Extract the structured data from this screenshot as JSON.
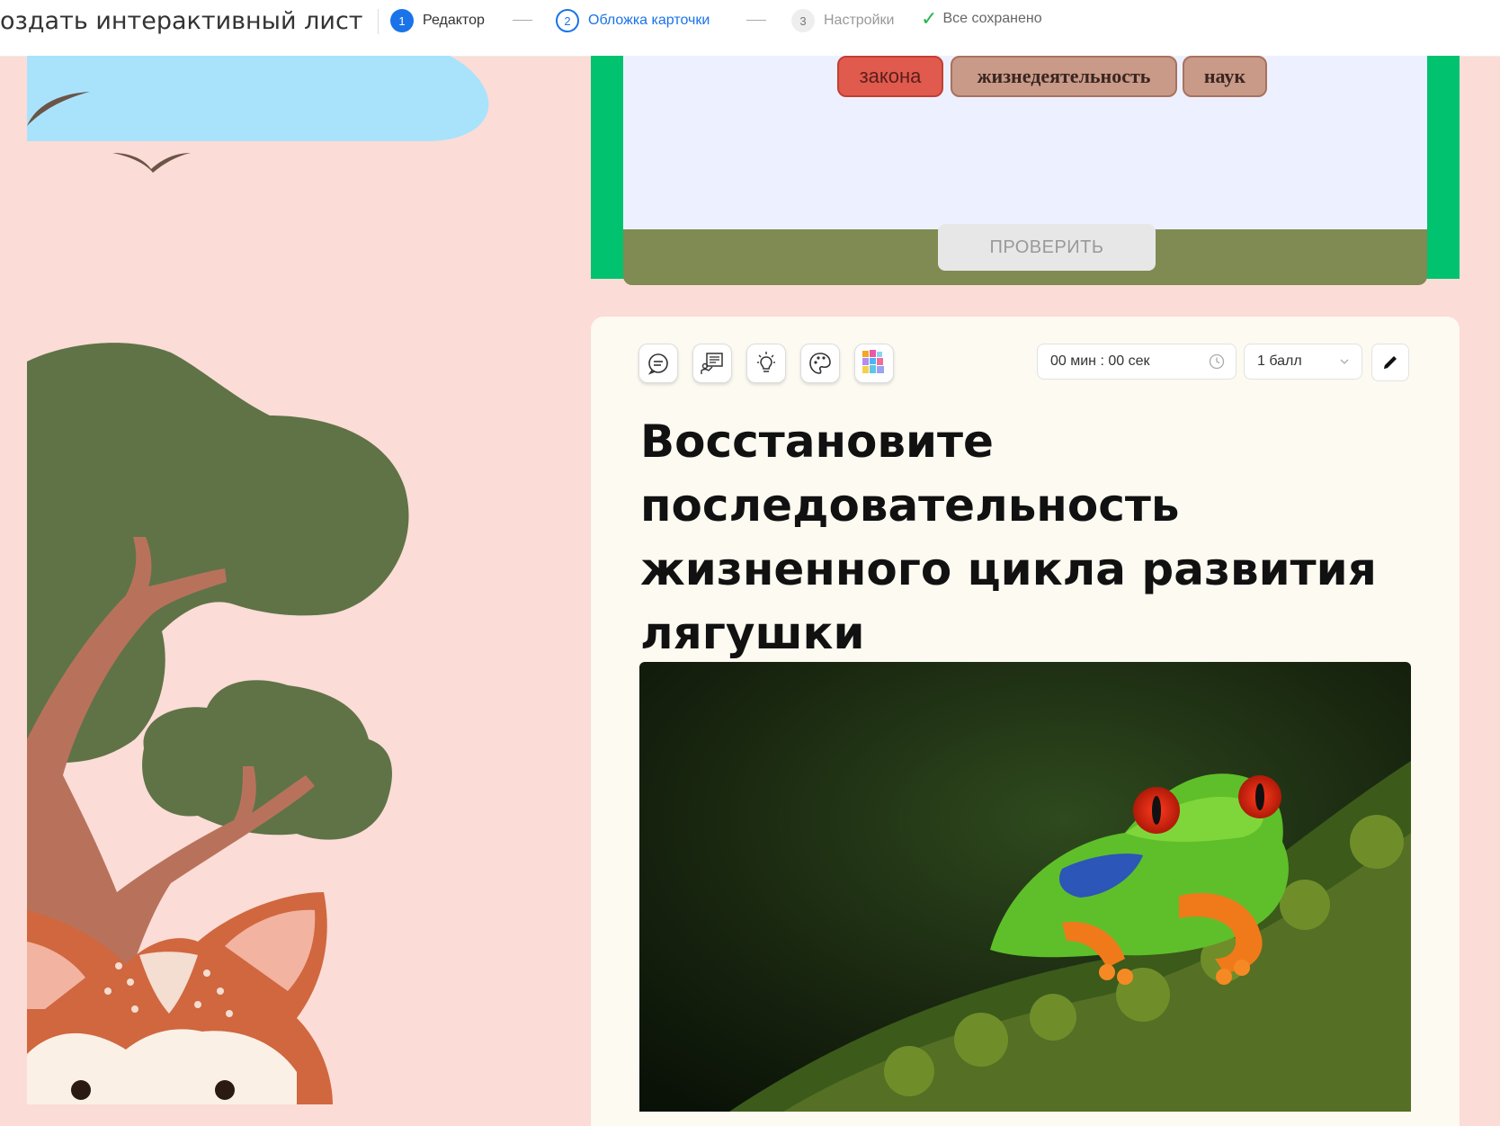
{
  "topbar": {
    "title": "оздать интерактивный лист",
    "steps": [
      {
        "num": "1",
        "label": "Редактор"
      },
      {
        "num": "2",
        "label": "Обложка карточки"
      },
      {
        "num": "3",
        "label": "Настройки"
      }
    ],
    "saved": "Все сохранено"
  },
  "exercise": {
    "chips": [
      "закона",
      "жизнедеятельность",
      "наук"
    ],
    "check_button": "ПРОВЕРИТЬ"
  },
  "card": {
    "timer": "00 мин : 00 сек",
    "points": "1 балл",
    "question": "Восстановите последовательность жизненного цикла развития лягушки",
    "tools": [
      "comment-icon",
      "presentation-icon",
      "lightbulb-icon",
      "palette-icon",
      "colorful-grid-icon"
    ]
  },
  "colors": {
    "background": "#fbdcd6",
    "green_frame": "#00c26f",
    "accent_blue": "#1a73e8",
    "card_bg": "#fcfaf1"
  }
}
